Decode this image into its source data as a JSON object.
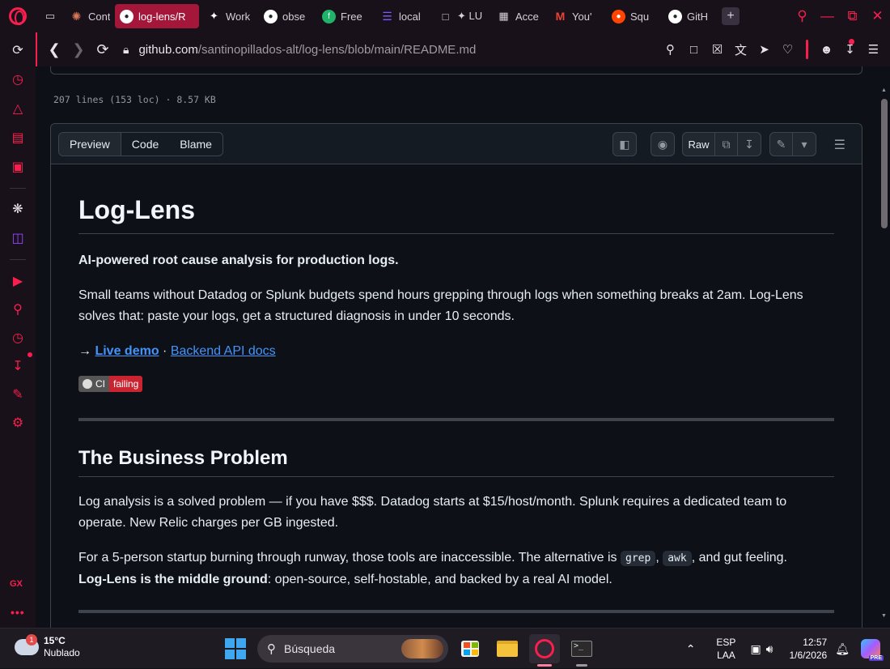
{
  "browser": {
    "tabs": [
      {
        "label": "Cont",
        "icon": "claude-icon",
        "color": "#d97757"
      },
      {
        "label": "log-lens/R",
        "icon": "github-icon",
        "color": "#24292f",
        "active": true
      },
      {
        "label": "Work",
        "icon": "workflow-icon",
        "color": "#555555"
      },
      {
        "label": "obse",
        "icon": "github-icon",
        "color": "#24292f"
      },
      {
        "label": "Free",
        "icon": "freepik-icon",
        "color": "#1fb46a"
      },
      {
        "label": "local",
        "icon": "layers-icon",
        "color": "#7b5cff"
      },
      {
        "label": "✦ LU",
        "icon": "document-icon",
        "color": "#555555"
      },
      {
        "label": "Acce",
        "icon": "grid-icon",
        "color": "#555555"
      },
      {
        "label": "You'",
        "icon": "gmail-icon",
        "color": "#ea4335"
      },
      {
        "label": "Squ",
        "icon": "reddit-icon",
        "color": "#ff4500"
      },
      {
        "label": "GitH",
        "icon": "github-icon",
        "color": "#24292f"
      }
    ],
    "url_host": "github.com",
    "url_path": "/santinopillados-alt/log-lens/blob/main/README.md"
  },
  "file": {
    "meta": "207 lines (153 loc) · 8.57 KB",
    "view_tabs": [
      "Preview",
      "Code",
      "Blame"
    ],
    "raw_label": "Raw"
  },
  "readme": {
    "title": "Log-Lens",
    "tagline": "AI-powered root cause analysis for production logs.",
    "intro": "Small teams without Datadog or Splunk budgets spend hours grepping through logs when something breaks at 2am. Log-Lens solves that: paste your logs, get a structured diagnosis in under 10 seconds.",
    "arrow": "→ ",
    "link_demo": "Live demo",
    "sep": " · ",
    "link_api": "Backend API docs",
    "badge_left": "CI",
    "badge_right": "failing",
    "h2": "The Business Problem",
    "p1": "Log analysis is a solved problem — if you have $$$. Datadog starts at $15/host/month. Splunk requires a dedicated team to operate. New Relic charges per GB ingested.",
    "p2_a": "For a 5-person startup burning through runway, those tools are inaccessible. The alternative is ",
    "code1": "grep",
    "comma": ", ",
    "code2": "awk",
    "p2_b": ", and gut feeling.",
    "p2_bold": "Log-Lens is the middle ground",
    "p2_c": ": open-source, self-hostable, and backed by a real AI model."
  },
  "taskbar": {
    "temp": "15°C",
    "condition": "Nublado",
    "weather_badge": "1",
    "search": "Búsqueda",
    "lang1": "ESP",
    "lang2": "LAA",
    "time": "12:57",
    "date": "1/6/2026",
    "copilot_badge": "PRE"
  }
}
